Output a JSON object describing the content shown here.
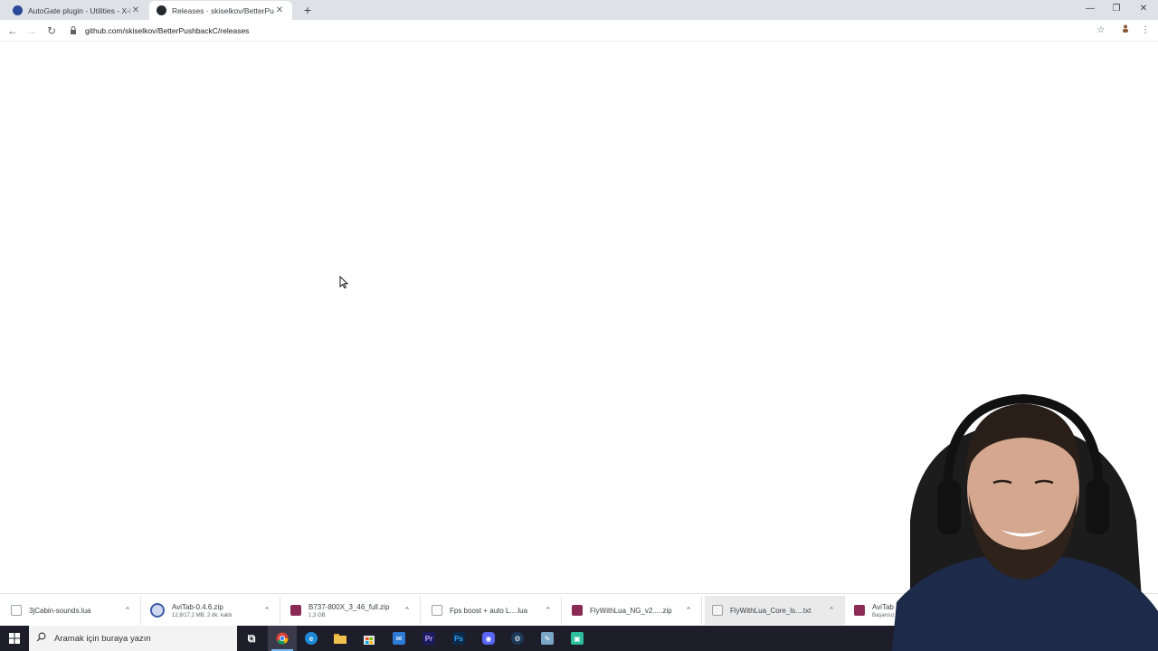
{
  "tabs": [
    {
      "title": "AutoGate plugin - Utilities - X-Pl",
      "active": false,
      "favicon": "xplane-globe-icon"
    },
    {
      "title": "Releases · skiselkov/BetterPushb",
      "active": true,
      "favicon": "github-icon"
    }
  ],
  "window_controls": {
    "minimize": "—",
    "restore": "❐",
    "close": "✕"
  },
  "toolbar": {
    "back": "←",
    "forward": "→",
    "reload": "↻",
    "url": "github.com/skiselkov/BetterPushbackC/releases",
    "lock_glyph": "🔒",
    "star": "☆",
    "menu": "⋮",
    "new_tab": "+"
  },
  "downloads": [
    {
      "name": "3jCabin-sounds.lua",
      "sub": "",
      "icon": "file-icon",
      "color": "#ffffff"
    },
    {
      "name": "AviTab-0.4.6.zip",
      "sub": "12,8/17,2 MB, 2 dk. kaldı",
      "icon": "download-progress-icon",
      "color": "#3b5ba9"
    },
    {
      "name": "B737-800X_3_46_full.zip",
      "sub": "1,3 GB",
      "icon": "winrar-icon",
      "color": "#8b2a55"
    },
    {
      "name": "Fps boost + auto L....lua",
      "sub": "",
      "icon": "file-icon",
      "color": "#ffffff"
    },
    {
      "name": "FlyWithLua_NG_v2.....zip",
      "sub": "",
      "icon": "winrar-icon",
      "color": "#8b2a55"
    },
    {
      "name": "FlyWithLua_Core_ls....txt",
      "sub": "",
      "icon": "text-file-icon",
      "color": "#ffffff"
    },
    {
      "name": "AviTab",
      "sub": "Başarısız",
      "icon": "winrar-icon",
      "color": "#8b2a55"
    }
  ],
  "taskbar": {
    "search_placeholder": "Aramak için buraya yazın",
    "icons": [
      {
        "name": "task-view-icon",
        "glyph": "⧉",
        "color": "#1e1e2b"
      },
      {
        "name": "chrome-icon",
        "glyph": "",
        "color": "#e84b3c",
        "active": true
      },
      {
        "name": "edge-icon",
        "glyph": "e",
        "color": "#1f8ad8"
      },
      {
        "name": "file-explorer-icon",
        "glyph": "",
        "color": "#f2c14e"
      },
      {
        "name": "store-icon",
        "glyph": "▦",
        "color": "#e0e0e0"
      },
      {
        "name": "mail-icon",
        "glyph": "✉",
        "color": "#2c7bd6"
      },
      {
        "name": "premiere-icon",
        "glyph": "Pr",
        "color": "#1b1b5e"
      },
      {
        "name": "photoshop-icon",
        "glyph": "Ps",
        "color": "#0d2a4a"
      },
      {
        "name": "discord-icon",
        "glyph": "◉",
        "color": "#5865f2"
      },
      {
        "name": "steam-icon",
        "glyph": "⚙",
        "color": "#1b3a5a"
      },
      {
        "name": "notepad-icon",
        "glyph": "✎",
        "color": "#7aa7c7"
      },
      {
        "name": "streamlabs-icon",
        "glyph": "▣",
        "color": "#2dbe9c"
      }
    ]
  }
}
